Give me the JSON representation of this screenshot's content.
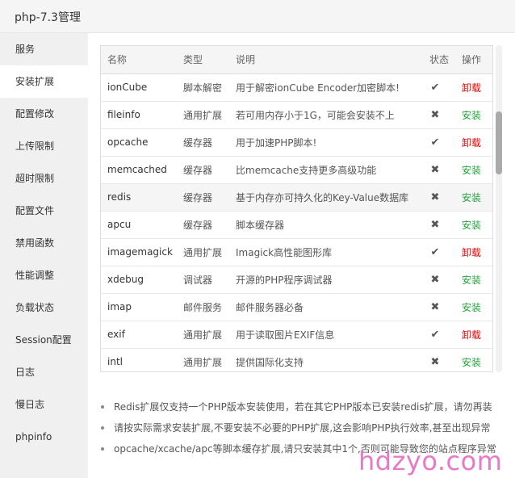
{
  "window": {
    "title": "php-7.3管理"
  },
  "sidebar": {
    "items": [
      {
        "label": "服务"
      },
      {
        "label": "安装扩展"
      },
      {
        "label": "配置修改"
      },
      {
        "label": "上传限制"
      },
      {
        "label": "超时限制"
      },
      {
        "label": "配置文件"
      },
      {
        "label": "禁用函数"
      },
      {
        "label": "性能调整"
      },
      {
        "label": "负载状态"
      },
      {
        "label": "Session配置"
      },
      {
        "label": "日志"
      },
      {
        "label": "慢日志"
      },
      {
        "label": "phpinfo"
      }
    ],
    "active_index": 1
  },
  "table": {
    "headers": {
      "name": "名称",
      "type": "类型",
      "desc": "说明",
      "status": "状态",
      "action": "操作"
    },
    "rows": [
      {
        "name": "ionCube",
        "type": "脚本解密",
        "desc": "用于解密ionCube Encoder加密脚本!",
        "status": "installed",
        "action": "卸载"
      },
      {
        "name": "fileinfo",
        "type": "通用扩展",
        "desc": "若可用内存小于1G，可能会安装不上",
        "status": "not-installed",
        "action": "安装"
      },
      {
        "name": "opcache",
        "type": "缓存器",
        "desc": "用于加速PHP脚本!",
        "status": "installed",
        "action": "卸载"
      },
      {
        "name": "memcached",
        "type": "缓存器",
        "desc": "比memcache支持更多高级功能",
        "status": "not-installed",
        "action": "安装"
      },
      {
        "name": "redis",
        "type": "缓存器",
        "desc": "基于内存亦可持久化的Key-Value数据库",
        "status": "not-installed",
        "action": "安装"
      },
      {
        "name": "apcu",
        "type": "缓存器",
        "desc": "脚本缓存器",
        "status": "not-installed",
        "action": "安装"
      },
      {
        "name": "imagemagick",
        "type": "通用扩展",
        "desc": "Imagick高性能图形库",
        "status": "installed",
        "action": "卸载"
      },
      {
        "name": "xdebug",
        "type": "调试器",
        "desc": "开源的PHP程序调试器",
        "status": "not-installed",
        "action": "安装"
      },
      {
        "name": "imap",
        "type": "邮件服务",
        "desc": "邮件服务器必备",
        "status": "not-installed",
        "action": "安装"
      },
      {
        "name": "exif",
        "type": "通用扩展",
        "desc": "用于读取图片EXIF信息",
        "status": "installed",
        "action": "卸载"
      },
      {
        "name": "intl",
        "type": "通用扩展",
        "desc": "提供国际化支持",
        "status": "not-installed",
        "action": "安装"
      }
    ],
    "highlighted_index": 4
  },
  "notes": [
    "Redis扩展仅支持一个PHP版本安装使用，若在其它PHP版本已安装redis扩展，请勿再装",
    "请按实际需求安装扩展,不要安装不必要的PHP扩展,这会影响PHP执行效率,甚至出现异常",
    "opcache/xcache/apc等脚本缓存扩展,请只安装其中1个,否则可能导致您的站点程序异常"
  ],
  "watermark": {
    "text": "hdzyo.com"
  },
  "colors": {
    "uninstall": "#ee0000",
    "install": "#20a53a",
    "watermark": "#e879c7"
  },
  "icons": {
    "installed": "check-icon",
    "not_installed": "cross-icon"
  }
}
